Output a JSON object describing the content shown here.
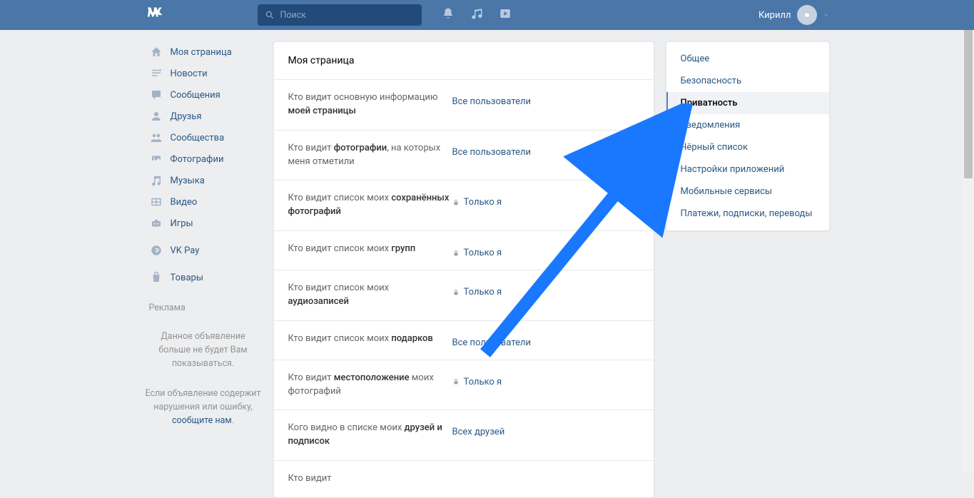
{
  "header": {
    "search_placeholder": "Поиск",
    "username": "Кирилл"
  },
  "sidebar": {
    "items": [
      {
        "label": "Моя страница"
      },
      {
        "label": "Новости"
      },
      {
        "label": "Сообщения"
      },
      {
        "label": "Друзья"
      },
      {
        "label": "Сообщества"
      },
      {
        "label": "Фотографии"
      },
      {
        "label": "Музыка"
      },
      {
        "label": "Видео"
      },
      {
        "label": "Игры"
      }
    ],
    "items2": [
      {
        "label": "VK Pay"
      }
    ],
    "items3": [
      {
        "label": "Товары"
      }
    ],
    "ad_label": "Реклама",
    "ad_text1": "Данное объявление больше не будет Вам показываться.",
    "ad_text2_prefix": "Если объявление содержит нарушения или ошибку, ",
    "ad_text2_link": "сообщите нам",
    "ad_text2_suffix": "."
  },
  "content": {
    "title": "Моя страница",
    "rows": [
      {
        "label_pre": "Кто видит основную информацию ",
        "label_bold": "моей страницы",
        "value": "Все пользователи",
        "lock": false
      },
      {
        "label_pre": "Кто видит ",
        "label_bold": "фотографии",
        "label_post": ", на которых меня отметили",
        "value": "Все пользователи",
        "lock": false
      },
      {
        "label_pre": "Кто видит список моих ",
        "label_bold": "сохранённых фотографий",
        "value": "Только я",
        "lock": true
      },
      {
        "label_pre": "Кто видит список моих ",
        "label_bold": "групп",
        "value": "Только я",
        "lock": true
      },
      {
        "label_pre": "Кто видит список моих ",
        "label_bold": "аудиозаписей",
        "value": "Только я",
        "lock": true
      },
      {
        "label_pre": "Кто видит список моих ",
        "label_bold": "подарков",
        "value": "Все пользователи",
        "lock": false
      },
      {
        "label_pre": "Кто видит ",
        "label_bold": "местоположение",
        "label_post": " моих фотографий",
        "value": "Только я",
        "lock": true
      },
      {
        "label_pre": "Кого видно в списке моих ",
        "label_bold": "друзей и подписок",
        "value": "Всех друзей",
        "lock": false
      },
      {
        "label_pre": "Кто видит",
        "label_bold": "",
        "value": "",
        "lock": false
      }
    ]
  },
  "tabs": [
    {
      "label": "Общее",
      "active": false
    },
    {
      "label": "Безопасность",
      "active": false
    },
    {
      "label": "Приватность",
      "active": true
    },
    {
      "label": "Уведомления",
      "active": false
    },
    {
      "label": "Чёрный список",
      "active": false
    },
    {
      "label": "Настройки приложений",
      "active": false
    },
    {
      "label": "Мобильные сервисы",
      "active": false
    },
    {
      "label": "Платежи, подписки, переводы",
      "active": false
    }
  ]
}
